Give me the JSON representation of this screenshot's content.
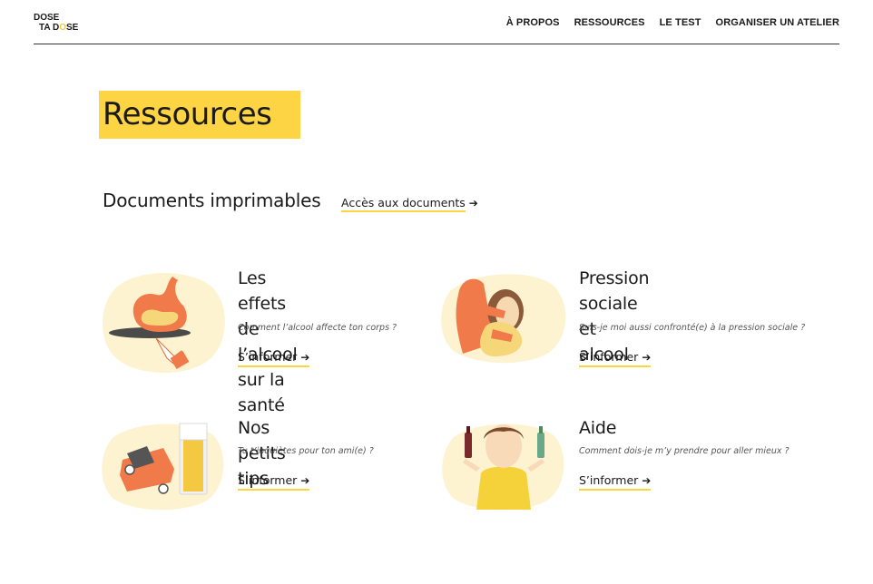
{
  "header": {
    "logo_line1": "DOSE",
    "logo_line2_a": "TA D",
    "logo_line2_b": "O",
    "logo_line2_c": "SE",
    "nav": [
      "À PROPOS",
      "RESSOURCES",
      "LE TEST",
      "ORGANISER UN ATELIER"
    ]
  },
  "page": {
    "title": "Ressources"
  },
  "documents": {
    "title": "Documents imprimables",
    "link": "Accès aux documents",
    "arrow": "➔"
  },
  "cards": [
    {
      "title_l1": "Les effets de l’alcool",
      "title_l2": "sur la santé",
      "subtitle": "Comment l’alcool affecte ton corps ?",
      "cta": "S’informer",
      "arrow": "➔"
    },
    {
      "title_l1": "Pression sociale et",
      "title_l2": "alcool",
      "subtitle": "Suis-je moi aussi confronté(e) à la pression sociale ?",
      "cta": "S’informer",
      "arrow": "➔"
    },
    {
      "title_l1": "Nos petits tips",
      "title_l2": "",
      "subtitle": "Tu t’inquiètes pour ton ami(e) ?",
      "cta": "S’informer",
      "arrow": "➔"
    },
    {
      "title_l1": "Aide",
      "title_l2": "",
      "subtitle": "Comment dois-je m’y prendre pour aller mieux ?",
      "cta": "S’informer",
      "arrow": "➔"
    }
  ],
  "colors": {
    "accent_yellow": "#fdd443",
    "blob_cream": "#fdf3d0",
    "illustration_orange": "#f07a4a"
  }
}
